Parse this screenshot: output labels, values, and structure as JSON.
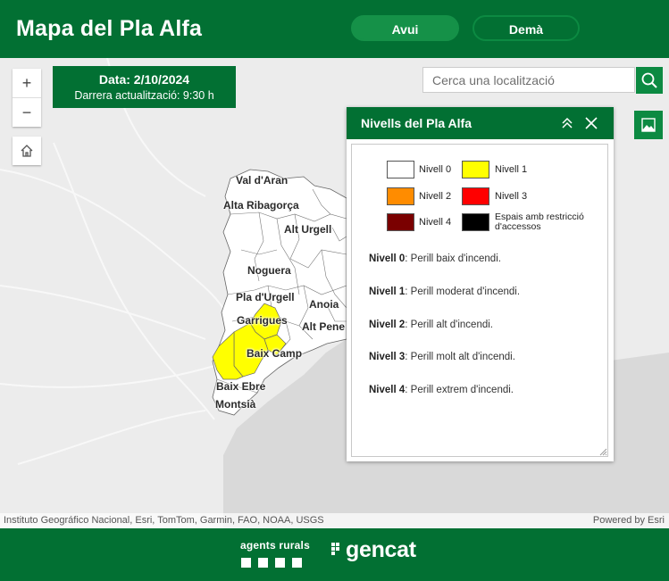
{
  "header": {
    "title": "Mapa del Pla Alfa",
    "tabs": [
      {
        "label": "Avui",
        "active": true
      },
      {
        "label": "Demà",
        "active": false
      }
    ],
    "color": "#027033"
  },
  "map_controls": {
    "zoom_in": "+",
    "zoom_out": "−",
    "home_icon": "home-icon"
  },
  "date_box": {
    "date": "Data: 2/10/2024",
    "updated": "Darrera actualització: 9:30 h"
  },
  "search": {
    "placeholder": "Cerca una localització",
    "icon": "search-icon"
  },
  "legend_toggle_icon": "image-icon",
  "map_labels": [
    "Val d'Aran",
    "Alta Ribagorça",
    "Alt Urgell",
    "Noguera",
    "Pla d'Urgell",
    "Garrigues",
    "Anoia",
    "Alt Pene",
    "Baix Camp",
    "Baix Ebre",
    "Montsià"
  ],
  "legend_panel": {
    "title": "Nivells del Pla Alfa",
    "collapse_icon": "chevron-double-up-icon",
    "close_icon": "close-icon",
    "swatches": [
      {
        "label": "Nivell 0",
        "color": "#ffffff"
      },
      {
        "label": "Nivell 1",
        "color": "#ffff00"
      },
      {
        "label": "Nivell 2",
        "color": "#ff8c00"
      },
      {
        "label": "Nivell 3",
        "color": "#ff0000"
      },
      {
        "label": "Nivell 4",
        "color": "#7a0000"
      },
      {
        "label": "Espais amb restricció d'accessos",
        "color": "#000000"
      }
    ],
    "descriptions": [
      {
        "level": "Nivell 0",
        "text": ": Perill baix d'incendi."
      },
      {
        "level": "Nivell 1",
        "text": ": Perill moderat d'incendi."
      },
      {
        "level": "Nivell 2",
        "text": ": Perill alt d'incendi."
      },
      {
        "level": "Nivell 3",
        "text": ": Perill molt alt d'incendi."
      },
      {
        "level": "Nivell 4",
        "text": ": Perill extrem d'incendi."
      }
    ]
  },
  "attribution": {
    "sources": "Instituto Geográfico Nacional, Esri, TomTom, Garmin, FAO, NOAA, USGS",
    "powered": "Powered by Esri"
  },
  "footer": {
    "agents": "agents rurals",
    "gencat": "gencat"
  }
}
